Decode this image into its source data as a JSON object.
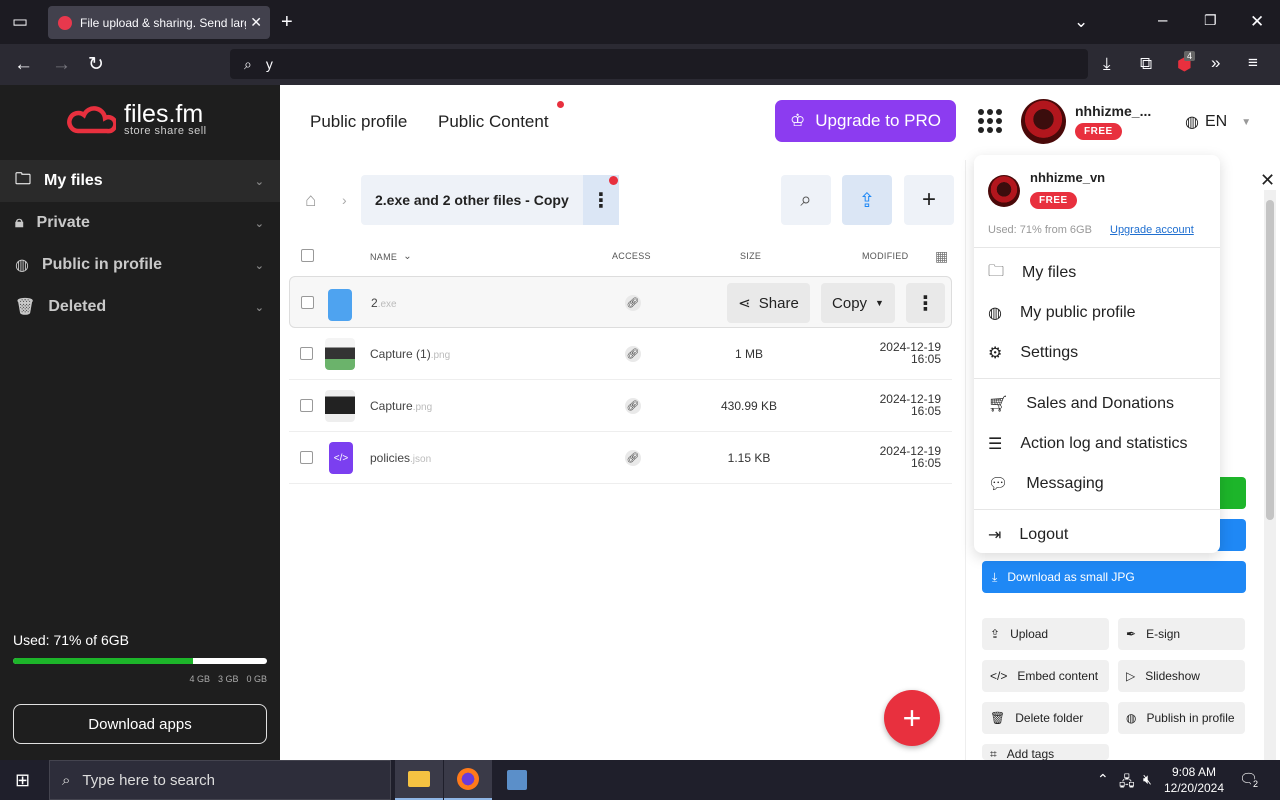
{
  "browser": {
    "tab_title": "File upload & sharing. Send larg",
    "url_text": "y",
    "extension_badge": "4"
  },
  "sidebar": {
    "logo_name": "files.fm",
    "logo_tagline": "store share sell",
    "items": [
      {
        "label": "My files",
        "icon": "folder-icon"
      },
      {
        "label": "Private",
        "icon": "lock-icon"
      },
      {
        "label": "Public in profile",
        "icon": "globe-icon"
      },
      {
        "label": "Deleted",
        "icon": "trash-icon"
      }
    ],
    "used_label": "Used: 71% of 6GB",
    "used_fraction": 0.71,
    "legend": [
      "4 GB",
      "3 GB",
      "0 GB"
    ],
    "download_apps": "Download apps",
    "usage_color": "#1db52a"
  },
  "header": {
    "public_profile": "Public profile",
    "public_content": "Public Content",
    "upgrade": "Upgrade to PRO",
    "username": "nhhizme_...",
    "badge": "FREE",
    "lang": "EN",
    "accent": "#8c3cf0"
  },
  "files": {
    "breadcrumb": "2.exe and 2 other files - Copy",
    "columns": {
      "name": "NAME",
      "access": "ACCESS",
      "size": "SIZE",
      "modified": "MODIFIED"
    },
    "share_label": "Share",
    "copy_label": "Copy",
    "rows": [
      {
        "name": "2",
        "ext": ".exe",
        "size": "",
        "date": "",
        "time": ""
      },
      {
        "name": "Capture (1)",
        "ext": ".png",
        "size": "1 MB",
        "date": "2024-12-19",
        "time": "16:05"
      },
      {
        "name": "Capture",
        "ext": ".png",
        "size": "430.99 KB",
        "date": "2024-12-19",
        "time": "16:05"
      },
      {
        "name": "policies",
        "ext": ".json",
        "size": "1.15 KB",
        "date": "2024-12-19",
        "time": "16:05"
      }
    ]
  },
  "dropdown": {
    "username": "nhhizme_vn",
    "badge": "FREE",
    "usage": "Used: 71% from 6GB",
    "upgrade_link": "Upgrade account",
    "items": [
      "My files",
      "My public profile",
      "Settings",
      "Sales and Donations",
      "Action log and statistics",
      "Messaging",
      "Logout"
    ]
  },
  "right_panel": {
    "download_small": "Download as small JPG",
    "buttons": [
      "Upload",
      "E-sign",
      "Embed content",
      "Slideshow",
      "Delete folder",
      "Publish in profile",
      "Add tags"
    ]
  },
  "taskbar": {
    "search_placeholder": "Type here to search",
    "time": "9:08 AM",
    "date": "12/20/2024",
    "notifications": "2"
  }
}
